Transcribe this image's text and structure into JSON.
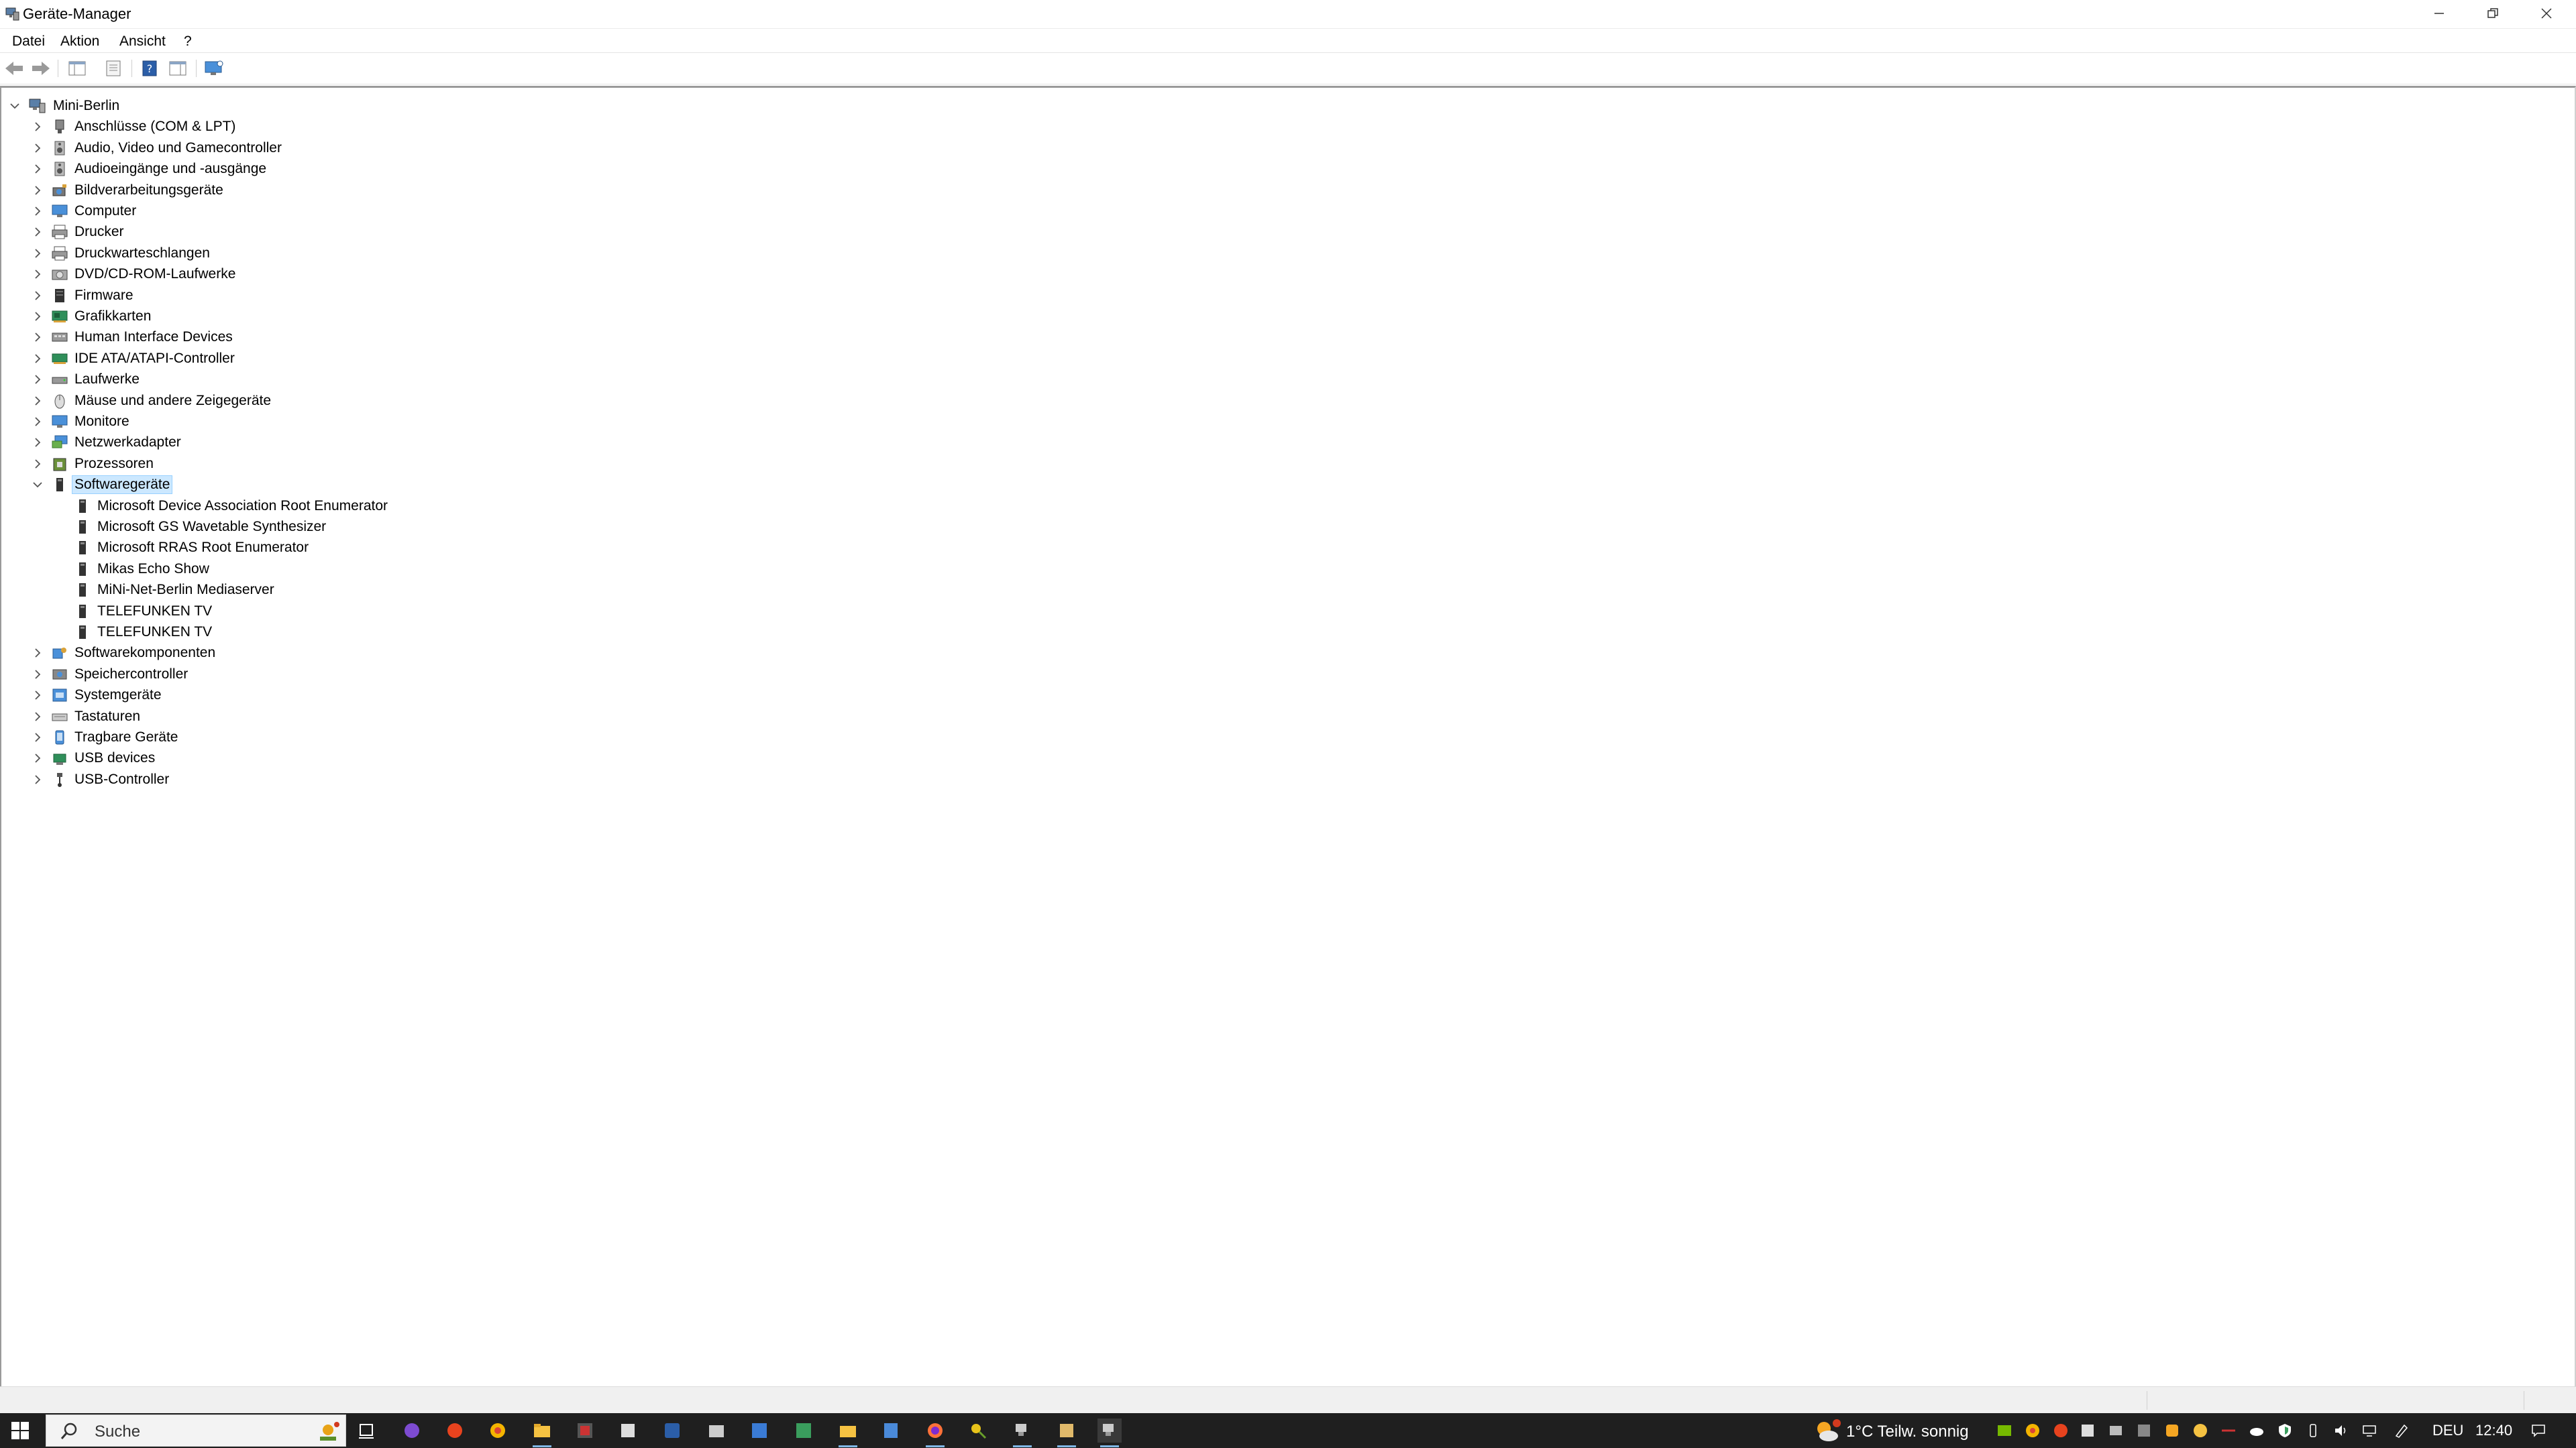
{
  "window": {
    "title": "Geräte-Manager"
  },
  "menu": [
    "Datei",
    "Aktion",
    "Ansicht",
    "?"
  ],
  "tree": {
    "root": "Mini-Berlin",
    "categories": [
      {
        "label": "Anschlüsse (COM & LPT)",
        "icon": "port-icon"
      },
      {
        "label": "Audio, Video und Gamecontroller",
        "icon": "speaker-icon"
      },
      {
        "label": "Audioeingänge und -ausgänge",
        "icon": "speaker-icon"
      },
      {
        "label": "Bildverarbeitungsgeräte",
        "icon": "camera-icon"
      },
      {
        "label": "Computer",
        "icon": "monitor-icon"
      },
      {
        "label": "Drucker",
        "icon": "printer-icon"
      },
      {
        "label": "Druckwarteschlangen",
        "icon": "printer-icon"
      },
      {
        "label": "DVD/CD-ROM-Laufwerke",
        "icon": "disc-drive-icon"
      },
      {
        "label": "Firmware",
        "icon": "chip-icon"
      },
      {
        "label": "Grafikkarten",
        "icon": "display-adapter-icon"
      },
      {
        "label": "Human Interface Devices",
        "icon": "hid-icon"
      },
      {
        "label": "IDE ATA/ATAPI-Controller",
        "icon": "controller-card-icon"
      },
      {
        "label": "Laufwerke",
        "icon": "hard-drive-icon"
      },
      {
        "label": "Mäuse und andere Zeigegeräte",
        "icon": "mouse-icon"
      },
      {
        "label": "Monitore",
        "icon": "monitor-icon"
      },
      {
        "label": "Netzwerkadapter",
        "icon": "network-icon"
      },
      {
        "label": "Prozessoren",
        "icon": "processor-icon"
      },
      {
        "label": "Softwaregeräte",
        "icon": "software-device-icon",
        "expanded": true,
        "selected": true,
        "children": [
          "Microsoft Device Association Root Enumerator",
          "Microsoft GS Wavetable Synthesizer",
          "Microsoft RRAS Root Enumerator",
          "Mikas Echo Show",
          "MiNi-Net-Berlin Mediaserver",
          "TELEFUNKEN TV",
          "TELEFUNKEN TV"
        ]
      },
      {
        "label": "Softwarekomponenten",
        "icon": "puzzle-icon"
      },
      {
        "label": "Speichercontroller",
        "icon": "storage-controller-icon"
      },
      {
        "label": "Systemgeräte",
        "icon": "system-device-icon"
      },
      {
        "label": "Tastaturen",
        "icon": "keyboard-icon"
      },
      {
        "label": "Tragbare Geräte",
        "icon": "portable-device-icon"
      },
      {
        "label": "USB devices",
        "icon": "usb-device-icon"
      },
      {
        "label": "USB-Controller",
        "icon": "usb-icon"
      }
    ]
  },
  "taskbar": {
    "search_placeholder": "Suche",
    "weather": "1°C Teilw. sonnig",
    "language": "DEU",
    "time": "12:40"
  },
  "colors": {
    "accent": "#0078d7",
    "taskbar": "#1f1f1f",
    "selection": "#cce8ff"
  }
}
